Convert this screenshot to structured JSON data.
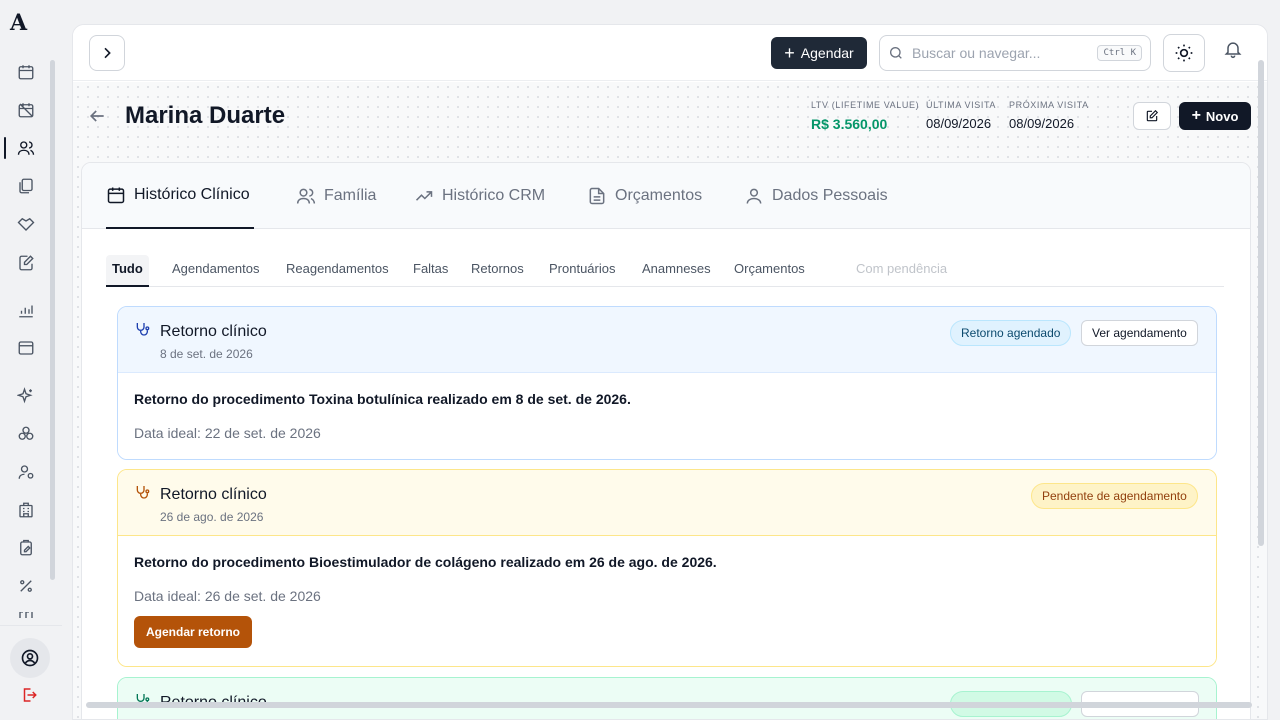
{
  "app": {
    "logo": "A"
  },
  "sidebar": {
    "icons": [
      "calendar-icon",
      "calendar-off-icon",
      "users-icon",
      "files-icon",
      "handshake-icon",
      "edit-doc-icon",
      "chart-icon",
      "inbox-icon",
      "sparkles-icon",
      "boxes-icon",
      "user-cog-icon",
      "building-icon",
      "clipboard-edit-icon",
      "percent-icon",
      "currency-icon"
    ],
    "active": "users-icon"
  },
  "topbar": {
    "agendar_label": "Agendar",
    "search_placeholder": "Buscar ou navegar...",
    "search_shortcut": "Ctrl K"
  },
  "patient": {
    "name": "Marina Duarte",
    "ltv_label": "LTV (LIFETIME VALUE)",
    "ltv_value": "R$ 3.560,00",
    "last_visit_label": "ÚLTIMA VISITA",
    "last_visit_value": "08/09/2026",
    "next_visit_label": "PRÓXIMA VISITA",
    "next_visit_value": "08/09/2026",
    "novo_label": "Novo"
  },
  "main_tabs": [
    {
      "label": "Histórico Clínico",
      "icon": "calendar-icon",
      "active": true
    },
    {
      "label": "Família",
      "icon": "users-icon"
    },
    {
      "label": "Histórico CRM",
      "icon": "trending-up-icon"
    },
    {
      "label": "Orçamentos",
      "icon": "file-text-icon"
    },
    {
      "label": "Dados Pessoais",
      "icon": "user-icon"
    }
  ],
  "sub_tabs": [
    "Tudo",
    "Agendamentos",
    "Reagendamentos",
    "Faltas",
    "Retornos",
    "Prontuários",
    "Anamneses",
    "Orçamentos",
    "Com pendência"
  ],
  "cards": [
    {
      "title": "Retorno clínico",
      "date": "8 de set. de 2026",
      "badge": "Retorno agendado",
      "action": "Ver agendamento",
      "description": "Retorno do procedimento Toxina botulínica realizado em 8 de set. de 2026.",
      "ideal": "Data ideal: 22 de set. de 2026"
    },
    {
      "title": "Retorno clínico",
      "date": "26 de ago. de 2026",
      "badge": "Pendente de agendamento",
      "description": "Retorno do procedimento Bioestimulador de colágeno realizado em 26 de ago. de 2026.",
      "ideal": "Data ideal: 26 de set. de 2026",
      "button": "Agendar retorno"
    },
    {
      "title": "Retorno clínico"
    }
  ],
  "colors": {
    "accent": "#111827",
    "ltv_green": "#059669",
    "blue_badge_bg": "#e0f2fe",
    "amber_badge_bg": "#fef3c7",
    "agendar_retorno_bg": "#b45309"
  }
}
